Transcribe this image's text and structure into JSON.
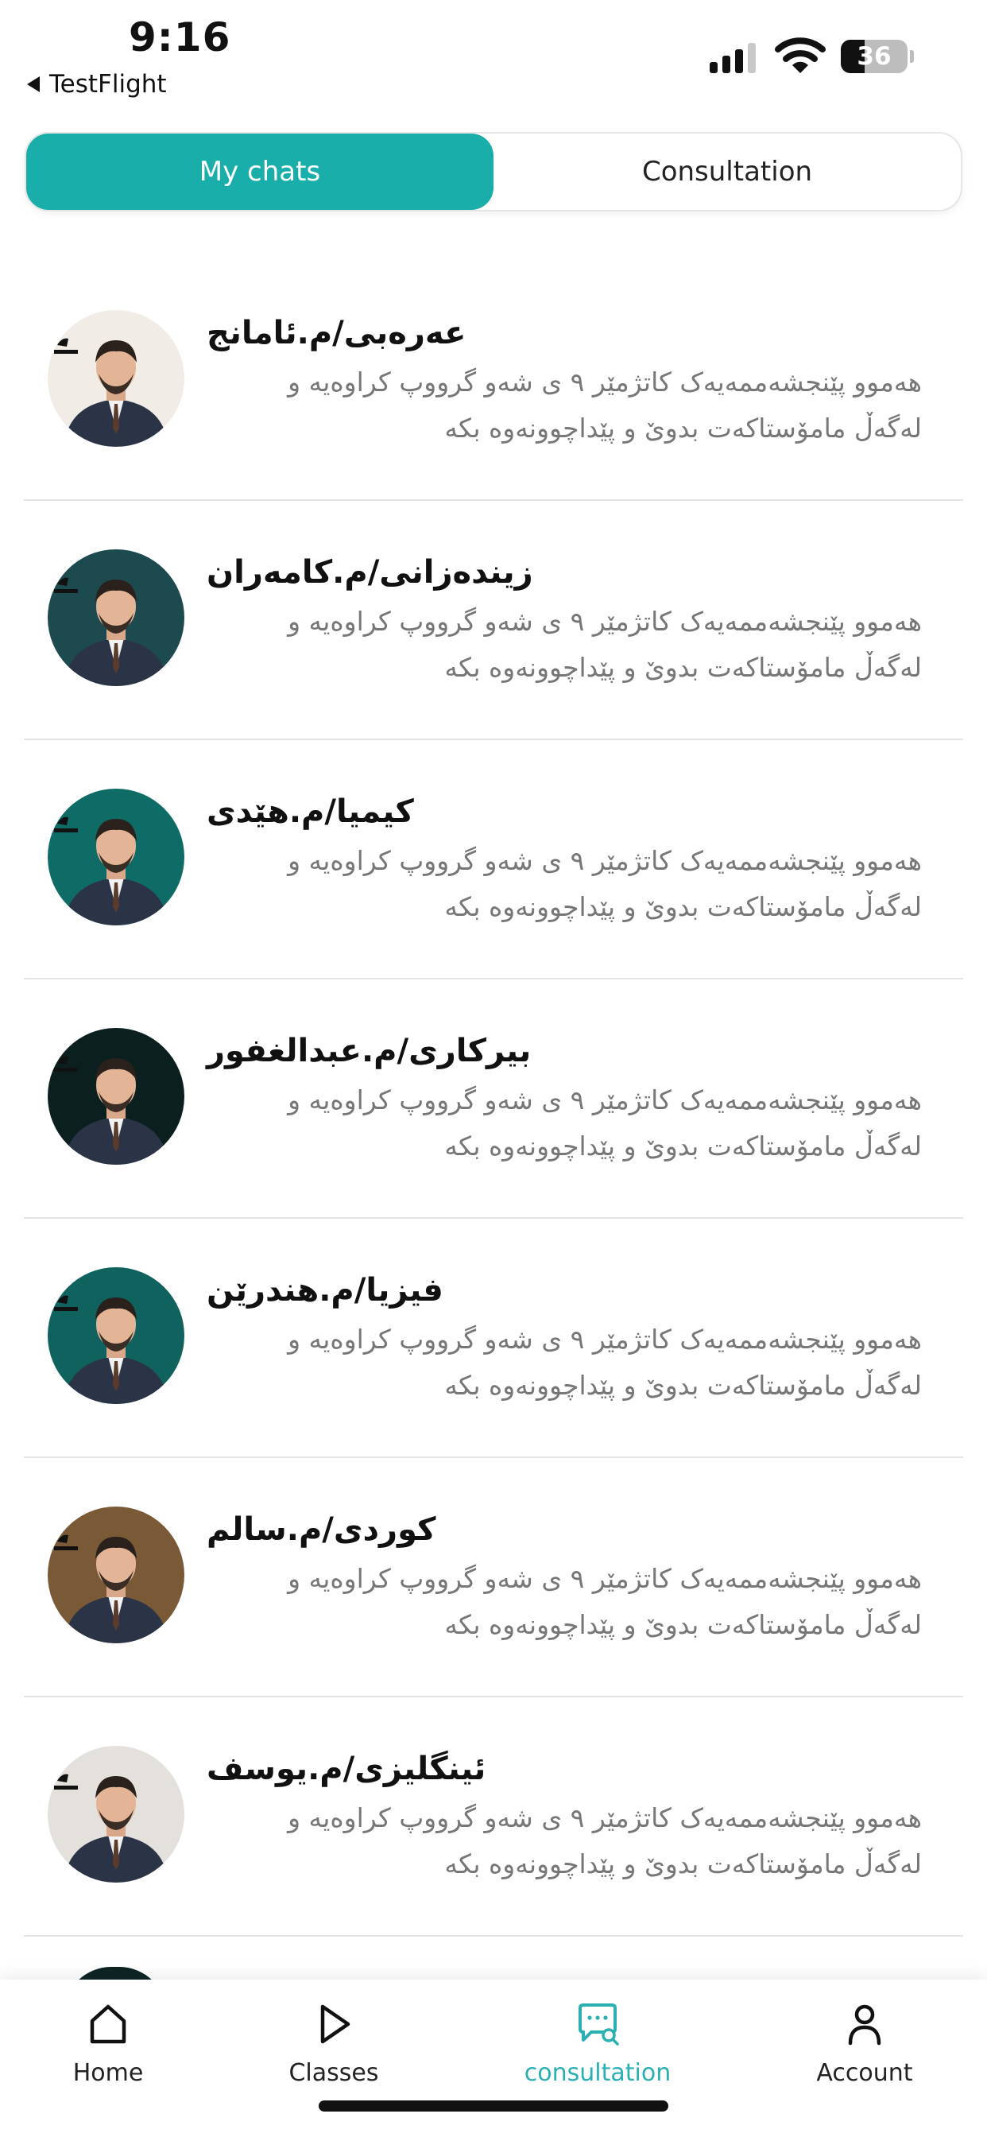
{
  "status_bar": {
    "time": "9:16",
    "back_app": "TestFlight",
    "battery_level": "36",
    "battery_fraction": 0.36,
    "signal_bars_active": 3,
    "signal_bars_total": 4
  },
  "segmented": {
    "my_chats_label": "My chats",
    "consultation_label": "Consultation",
    "active": "my_chats"
  },
  "chats": [
    {
      "name": "عەرەبی/م.ئامانج",
      "message_line1": "هەموو پێنجشەممەیەک کاتژمێر ٩ ی شەو گرووپ کراوەیە و",
      "message_line2": "لەگەڵ مامۆستاکەت بدوێ و پێداچوونەوە بکە",
      "avatar_bg": "#f1ede6"
    },
    {
      "name": "زیندەزانی/م.کامەران",
      "message_line1": "هەموو پێنجشەممەیەک کاتژمێر ٩ ی شەو گرووپ کراوەیە و",
      "message_line2": "لەگەڵ مامۆستاکەت بدوێ و پێداچوونەوە بکە",
      "avatar_bg": "#1d4a4f"
    },
    {
      "name": "کیمیا/م.هێدی",
      "message_line1": "هەموو پێنجشەممەیەک کاتژمێر ٩ ی شەو گرووپ کراوەیە و",
      "message_line2": "لەگەڵ مامۆستاکەت بدوێ و پێداچوونەوە بکە",
      "avatar_bg": "#0f6b66"
    },
    {
      "name": "بیرکاری/م.عبدالغفور",
      "message_line1": "هەموو پێنجشەممەیەک کاتژمێر ٩ ی شەو گرووپ کراوەیە و",
      "message_line2": "لەگەڵ مامۆستاکەت بدوێ و پێداچوونەوە بکە",
      "avatar_bg": "#0c1f1f"
    },
    {
      "name": "فیزیا/م.هندرێن",
      "message_line1": "هەموو پێنجشەممەیەک کاتژمێر ٩ ی شەو گرووپ کراوەیە و",
      "message_line2": "لەگەڵ مامۆستاکەت بدوێ و پێداچوونەوە بکە",
      "avatar_bg": "#0f625d"
    },
    {
      "name": "کوردی/م.سالم",
      "message_line1": "هەموو پێنجشەممەیەک کاتژمێر ٩ ی شەو گرووپ کراوەیە و",
      "message_line2": "لەگەڵ مامۆستاکەت بدوێ و پێداچوونەوە بکە",
      "avatar_bg": "#7a5a36"
    },
    {
      "name": "ئینگلیزی/م.یوسف",
      "message_line1": "هەموو پێنجشەممەیەک کاتژمێر ٩ ی شەو گرووپ کراوەیە و",
      "message_line2": "لەگەڵ مامۆستاکەت بدوێ و پێداچوونەوە بکە",
      "avatar_bg": "#e4e1dc"
    }
  ],
  "tabbar": {
    "items": [
      {
        "label": "Home",
        "icon": "home-icon"
      },
      {
        "label": "Classes",
        "icon": "play-icon"
      },
      {
        "label": "consultation",
        "icon": "chat-search-icon"
      },
      {
        "label": "Account",
        "icon": "person-icon"
      }
    ],
    "active_index": 2
  },
  "colors": {
    "accent": "#1aaeaa",
    "active_tab": "#2ab0b3",
    "muted_text": "#777777",
    "divider": "#e4e4e4"
  }
}
